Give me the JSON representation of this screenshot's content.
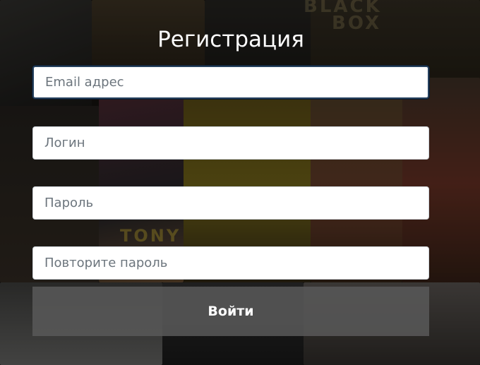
{
  "form": {
    "title": "Регистрация",
    "fields": [
      {
        "placeholder": "Email адрес",
        "value": ""
      },
      {
        "placeholder": "Логин",
        "value": ""
      },
      {
        "placeholder": "Пароль",
        "value": ""
      },
      {
        "placeholder": "Повторите пароль",
        "value": ""
      }
    ],
    "submit_label": "Войти"
  },
  "background": {
    "poster_texts": [
      "BLACK",
      "BOX",
      "TONY"
    ]
  },
  "colors": {
    "focus_border": "#26415e",
    "button_bg": "#585858",
    "title_text": "#ffffff"
  }
}
